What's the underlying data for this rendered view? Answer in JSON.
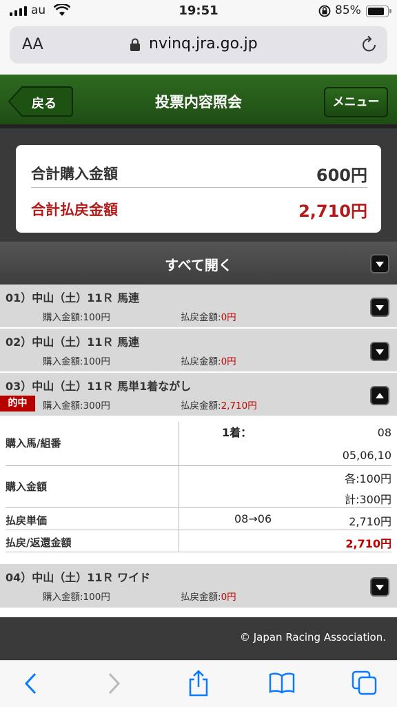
{
  "status": {
    "carrier": "au",
    "time": "19:51",
    "battery": "85%",
    "battery_level": 0.85
  },
  "browser": {
    "text_size_label": "AA",
    "host": "nvinq.jra.go.jp"
  },
  "header": {
    "back_label": "戻る",
    "title": "投票内容照会",
    "menu_label": "メニュー"
  },
  "summary": {
    "purchase_label": "合計購入金額",
    "purchase_value": "600円",
    "payout_label": "合計払戻金額",
    "payout_value": "2,710円"
  },
  "open_all_label": "すべて開く",
  "bets": [
    {
      "title": "01）中山（土）11Ｒ 馬連",
      "buy": "購入金額:100円",
      "pay_label": "払戻金額:",
      "pay_value": "0円"
    },
    {
      "title": "02）中山（土）11Ｒ 馬連",
      "buy": "購入金額:100円",
      "pay_label": "払戻金額:",
      "pay_value": "0円"
    },
    {
      "title": "03）中山（土）11Ｒ 馬単1着ながし",
      "hit_badge": "的中",
      "buy": "購入金額:300円",
      "pay_label": "払戻金額:",
      "pay_value": "2,710円"
    },
    {
      "title": "04）中山（土）11Ｒ ワイド",
      "buy": "購入金額:100円",
      "pay_label": "払戻金額:",
      "pay_value": "0円"
    }
  ],
  "detail": {
    "horses_label": "購入馬/組番",
    "first_label": "1着：",
    "first_value": "08",
    "second_value": "05,06,10",
    "amount_label": "購入金額",
    "each_value": "各:100円",
    "total_value": "計:300円",
    "unit_label": "払戻単価",
    "unit_combo": "08→06",
    "unit_value": "2,710円",
    "refund_label": "払戻/返還金額",
    "refund_value": "2,710円"
  },
  "footer": {
    "copyright": "© Japan Racing Association."
  }
}
